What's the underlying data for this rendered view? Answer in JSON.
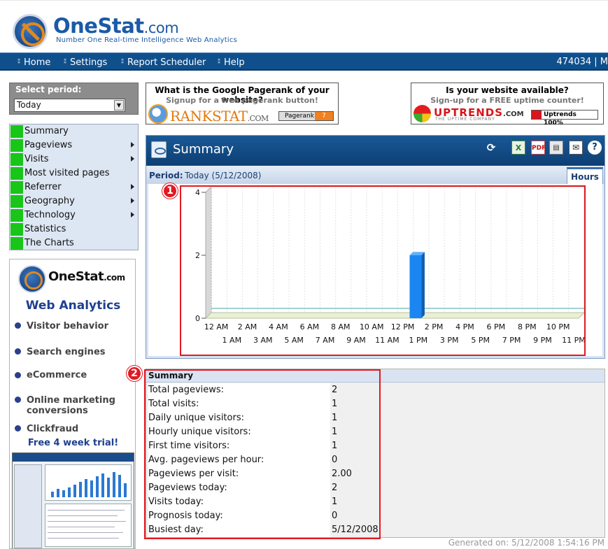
{
  "header": {
    "logo_name": "OneStat",
    "logo_suffix": ".com",
    "tagline": "Number One Real-time Intelligence Web Analytics"
  },
  "nav": {
    "items": [
      "Home",
      "Settings",
      "Report Scheduler",
      "Help"
    ],
    "account": "474034 | M"
  },
  "period": {
    "label": "Select period:",
    "selected": "Today"
  },
  "menu": {
    "items": [
      {
        "label": "Summary",
        "submenu": false
      },
      {
        "label": "Pageviews",
        "submenu": true
      },
      {
        "label": "Visits",
        "submenu": true
      },
      {
        "label": "Most visited pages",
        "submenu": false
      },
      {
        "label": "Referrer",
        "submenu": true
      },
      {
        "label": "Geography",
        "submenu": true
      },
      {
        "label": "Technology",
        "submenu": true
      },
      {
        "label": "Statistics",
        "submenu": false
      },
      {
        "label": "The Charts",
        "submenu": false
      }
    ],
    "accent": "#19c519"
  },
  "promo": {
    "logo_name": "OneStat",
    "logo_suffix": ".com",
    "title": "Web Analytics",
    "features": [
      "Visitor behavior",
      "Search engines",
      "eCommerce",
      "Online marketing conversions",
      "Clickfraud"
    ],
    "trial": "Free 4 week trial!"
  },
  "ad_rankstat": {
    "headline": "What is the Google Pagerank of your website?",
    "subline": "Signup for a free pagerank button!",
    "brand": "RANKSTAT",
    "brand_suffix": ".COM",
    "badge_label": "Pagerank",
    "badge_value": "7"
  },
  "ad_uptrends": {
    "headline": "Is your website available?",
    "subline": "Sign-up for a FREE uptime counter!",
    "brand": "UPTRENDS",
    "brand_suffix": ".COM",
    "tagline": "THE UPTIME COMPANY",
    "badge": "Uptrends 100%"
  },
  "panel": {
    "title": "Summary",
    "period_key": "Period:",
    "period_value": "Today (5/12/2008)",
    "tab": "Hours",
    "toolbar": [
      "refresh-icon",
      "excel-icon",
      "pdf-icon",
      "print-icon",
      "mail-icon",
      "help-icon"
    ]
  },
  "chart_data": {
    "type": "bar",
    "categories": [
      "12 AM",
      "1 AM",
      "2 AM",
      "3 AM",
      "4 AM",
      "5 AM",
      "6 AM",
      "7 AM",
      "8 AM",
      "9 AM",
      "10 AM",
      "11 AM",
      "12 PM",
      "1 PM",
      "2 PM",
      "3 PM",
      "4 PM",
      "5 PM",
      "6 PM",
      "7 PM",
      "8 PM",
      "9 PM",
      "10 PM",
      "11 PM"
    ],
    "values": [
      0,
      0,
      0,
      0,
      0,
      0,
      0,
      0,
      0,
      0,
      0,
      0,
      0,
      2,
      0,
      0,
      0,
      0,
      0,
      0,
      0,
      0,
      0,
      0
    ],
    "yticks": [
      "0",
      "2",
      "4"
    ],
    "ylim": [
      0,
      4
    ],
    "bar_color": "#1c86f0",
    "grid": true,
    "three_d": true
  },
  "summary": {
    "header": "Summary",
    "rows": [
      {
        "label": "Total pageviews:",
        "value": "2"
      },
      {
        "label": "Total visits:",
        "value": "1"
      },
      {
        "label": "Daily unique visitors:",
        "value": "1"
      },
      {
        "label": "Hourly unique visitors:",
        "value": "1"
      },
      {
        "label": "First time visitors:",
        "value": "1"
      },
      {
        "label": "Avg. pageviews per hour:",
        "value": "0"
      },
      {
        "label": "Pageviews per visit:",
        "value": "2.00"
      },
      {
        "label": "Pageviews today:",
        "value": "2"
      },
      {
        "label": "Visits today:",
        "value": "1"
      },
      {
        "label": "Prognosis today:",
        "value": "0"
      },
      {
        "label": "Busiest day:",
        "value": "5/12/2008"
      }
    ]
  },
  "footer": {
    "generated": "Generated on:  5/12/2008 1:54:16 PM"
  },
  "annotations": {
    "badge1": "1",
    "badge2": "2",
    "color": "#e01a22"
  }
}
